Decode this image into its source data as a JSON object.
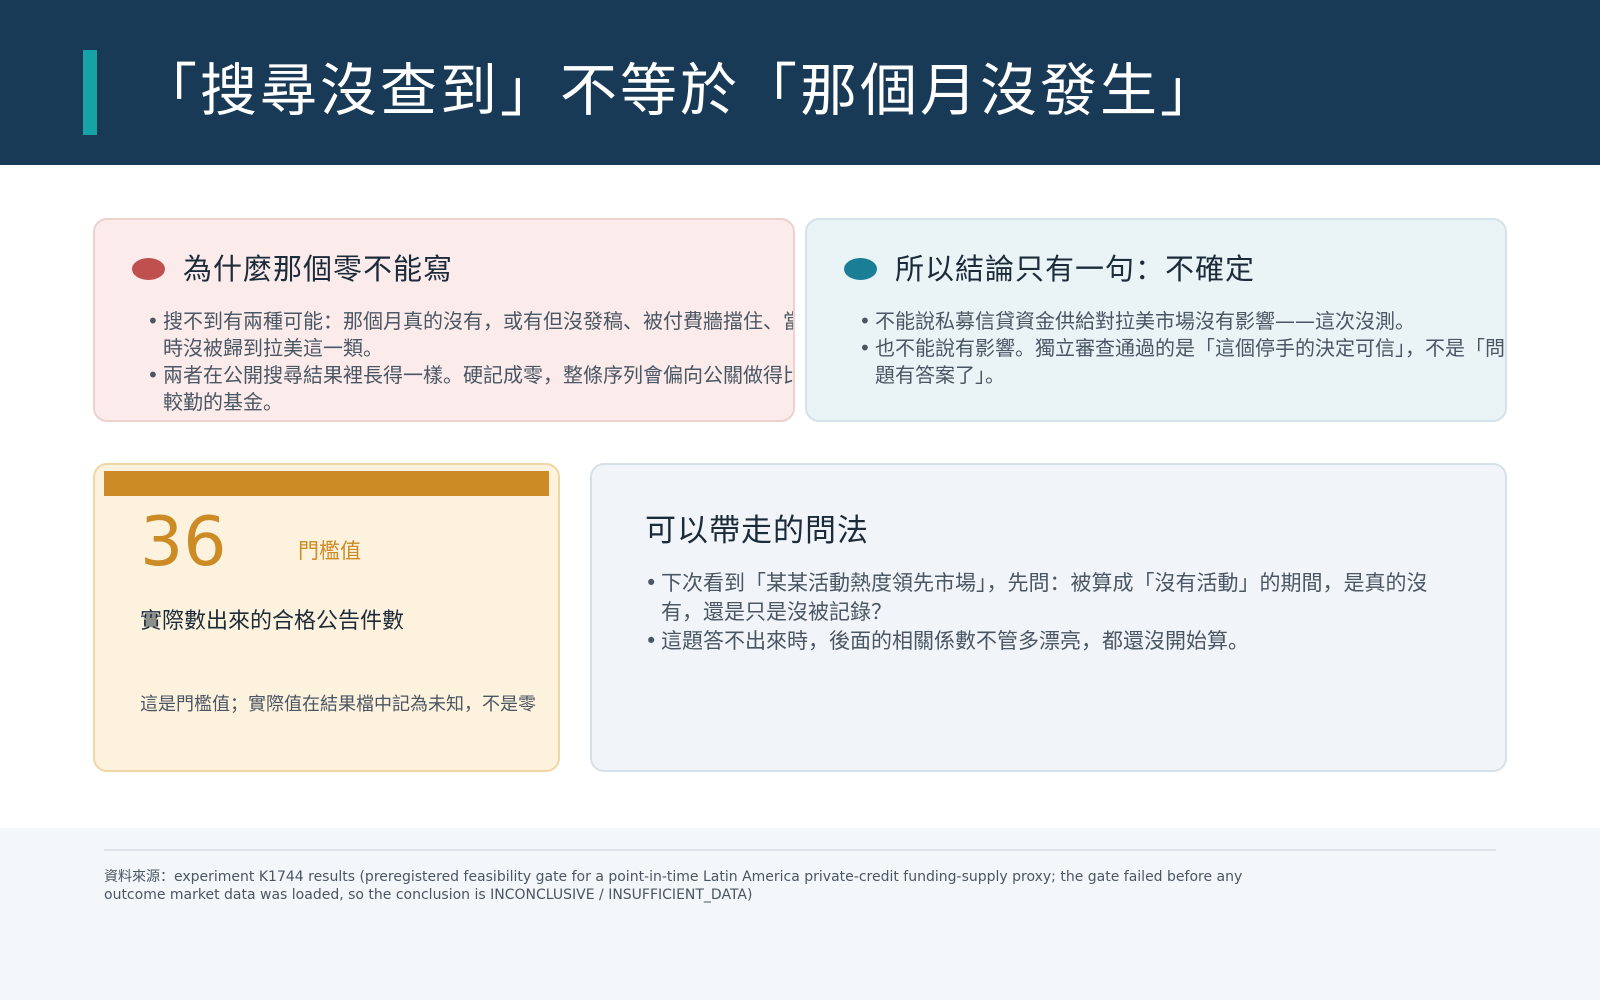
{
  "header": {
    "title": "「搜尋沒查到」不等於「那個月沒發生」"
  },
  "why_card": {
    "title": "為什麼那個零不能寫",
    "bullets": [
      "搜不到有兩種可能：那個月真的沒有，或有但沒發稿、被付費牆擋住、當時沒被歸到拉美這一類。",
      "兩者在公開搜尋結果裡長得一樣。硬記成零，整條序列會偏向公關做得比較勤的基金。"
    ]
  },
  "conclusion_card": {
    "title": "所以結論只有一句：不確定",
    "bullets": [
      "不能說私募信貸資金供給對拉美市場沒有影響——這次沒測。",
      "也不能說有影響。獨立審查通過的是「這個停手的決定可信」，不是「問題有答案了」。"
    ]
  },
  "metric_card": {
    "value": "36",
    "unit": "門檻值",
    "label": "實際數出來的合格公告件數",
    "note": "這是門檻值；實際值在結果檔中記為未知，不是零"
  },
  "takeaway_card": {
    "title": "可以帶走的問法",
    "bullets": [
      "下次看到「某某活動熱度領先市場」，先問：被算成「沒有活動」的期間，是真的沒有，還是只是沒被記錄？",
      "這題答不出來時，後面的相關係數不管多漂亮，都還沒開始算。"
    ]
  },
  "footer": {
    "source": "資料來源：experiment K1744 results (preregistered feasibility gate for a point-in-time Latin America private-credit funding-supply proxy; the gate failed before any outcome market data was loaded, so the conclusion is INCONCLUSIVE / INSUFFICIENT_DATA)"
  },
  "colors": {
    "header_bg": "#193a57",
    "accent_teal": "#17a2a6",
    "dot_red": "#c0504d",
    "dot_teal": "#1a7f96",
    "metric_orange": "#cd8b26"
  }
}
